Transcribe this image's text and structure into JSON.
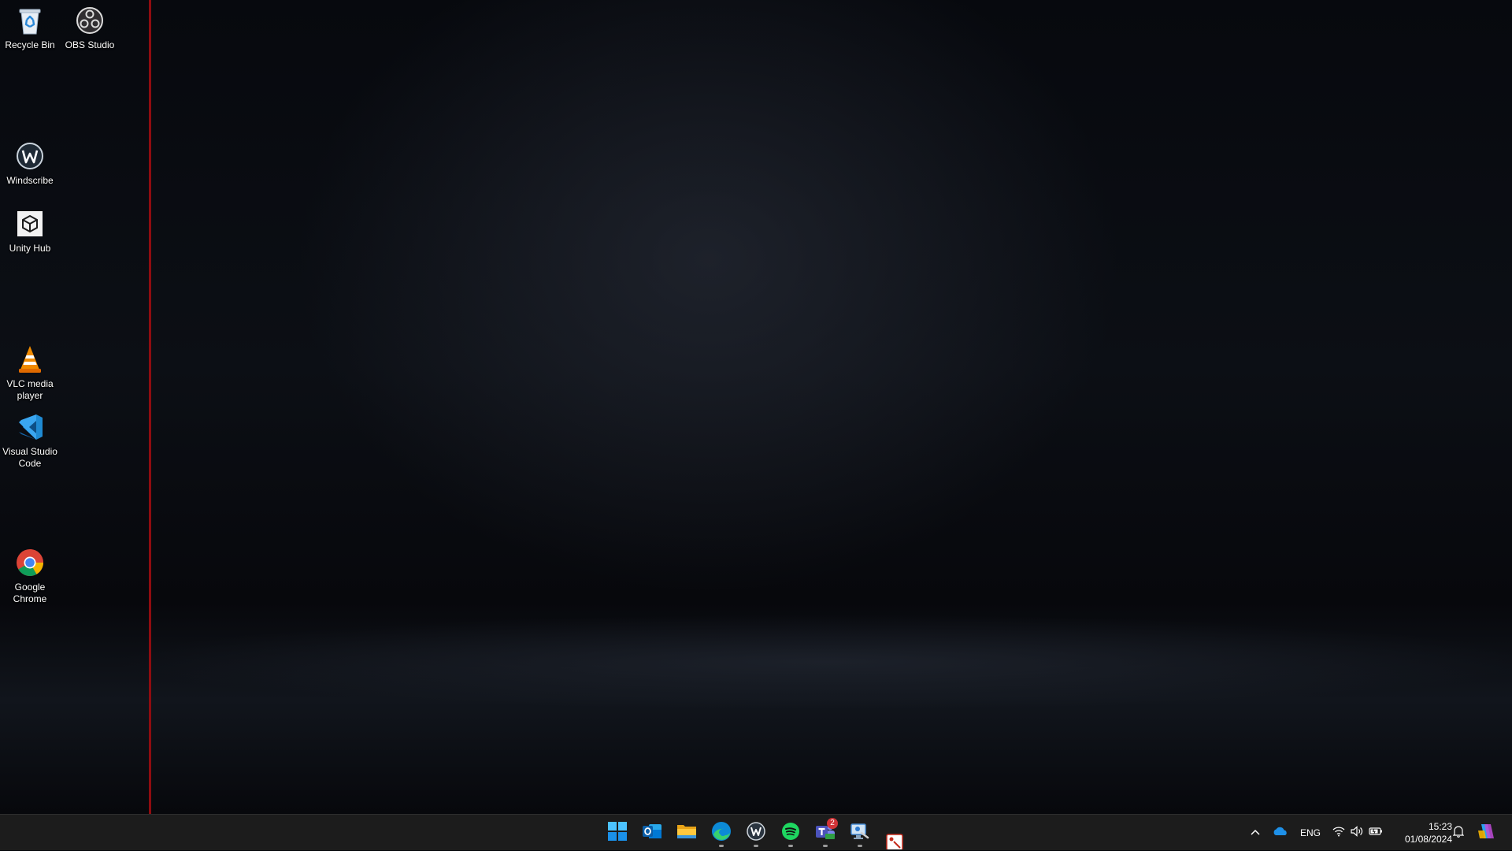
{
  "desktop": {
    "icons": [
      {
        "label": "Recycle Bin",
        "icon": "recycle-bin-icon"
      },
      {
        "label": "OBS Studio",
        "icon": "obs-studio-icon"
      },
      {
        "label": "Windscribe",
        "icon": "windscribe-icon"
      },
      {
        "label": "Unity Hub",
        "icon": "unity-hub-icon"
      },
      {
        "label": "VLC media\nplayer",
        "icon": "vlc-icon"
      },
      {
        "label": "Visual Studio\nCode",
        "icon": "vscode-icon"
      },
      {
        "label": "Google\nChrome",
        "icon": "chrome-icon"
      }
    ],
    "divider_color": "#8e0c10"
  },
  "taskbar": {
    "apps": [
      {
        "name": "Start",
        "icon": "windows-start-icon"
      },
      {
        "name": "Outlook",
        "icon": "outlook-icon"
      },
      {
        "name": "File Explorer",
        "icon": "file-explorer-icon"
      },
      {
        "name": "Microsoft Edge",
        "icon": "edge-icon",
        "running": true
      },
      {
        "name": "Windscribe",
        "icon": "windscribe-icon",
        "running": true
      },
      {
        "name": "Spotify",
        "icon": "spotify-icon",
        "running": true
      },
      {
        "name": "Microsoft Teams",
        "icon": "teams-icon",
        "running": true,
        "badge": "2"
      },
      {
        "name": "Remote Desktop",
        "icon": "remote-desktop-icon",
        "running": true
      },
      {
        "name": "Snipping Tool",
        "icon": "snipping-tool-icon"
      }
    ],
    "tray": {
      "language": "ENG",
      "time": "15:23",
      "date": "01/08/2024",
      "icons": [
        "chevron-up-icon",
        "onedrive-icon",
        "wifi-icon",
        "volume-icon",
        "battery-icon",
        "notification-bell-icon",
        "copilot-icon"
      ]
    }
  }
}
